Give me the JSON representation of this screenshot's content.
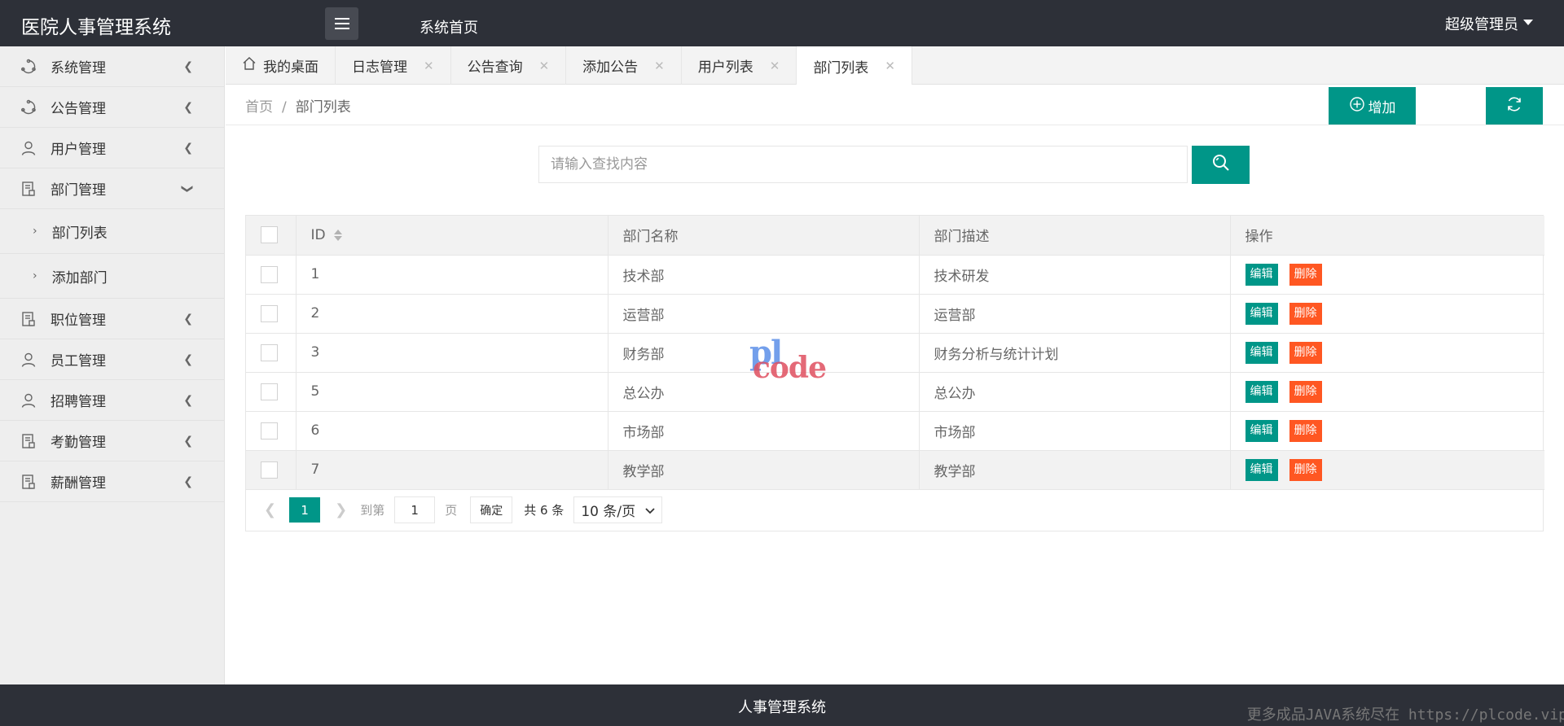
{
  "header": {
    "logo": "医院人事管理系统",
    "home_link": "系统首页",
    "user": "超级管理员"
  },
  "sidebar": {
    "items": [
      {
        "label": "系统管理",
        "icon": "cluster-icon"
      },
      {
        "label": "公告管理",
        "icon": "cluster-icon"
      },
      {
        "label": "用户管理",
        "icon": "user-icon"
      },
      {
        "label": "部门管理",
        "icon": "document-icon"
      },
      {
        "label": "职位管理",
        "icon": "document-icon"
      },
      {
        "label": "员工管理",
        "icon": "user-icon"
      },
      {
        "label": "招聘管理",
        "icon": "user-icon"
      },
      {
        "label": "考勤管理",
        "icon": "document-icon"
      },
      {
        "label": "薪酬管理",
        "icon": "document-icon"
      }
    ],
    "subitems": [
      {
        "label": "部门列表"
      },
      {
        "label": "添加部门"
      }
    ]
  },
  "tabs": [
    {
      "label": "我的桌面",
      "closable": false
    },
    {
      "label": "日志管理",
      "closable": true
    },
    {
      "label": "公告查询",
      "closable": true
    },
    {
      "label": "添加公告",
      "closable": true
    },
    {
      "label": "用户列表",
      "closable": true
    },
    {
      "label": "部门列表",
      "closable": true,
      "active": true
    }
  ],
  "breadcrumb": {
    "home": "首页",
    "sep": "/",
    "current": "部门列表"
  },
  "toolbar": {
    "add_label": "增加"
  },
  "search": {
    "placeholder": "请输入查找内容",
    "value": ""
  },
  "table": {
    "columns": [
      "ID",
      "部门名称",
      "部门描述",
      "操作"
    ],
    "rows": [
      {
        "id": "1",
        "name": "技术部",
        "desc": "技术研发"
      },
      {
        "id": "2",
        "name": "运营部",
        "desc": "运营部"
      },
      {
        "id": "3",
        "name": "财务部",
        "desc": "财务分析与统计计划"
      },
      {
        "id": "5",
        "name": "总公办",
        "desc": "总公办"
      },
      {
        "id": "6",
        "name": "市场部",
        "desc": "市场部"
      },
      {
        "id": "7",
        "name": "教学部",
        "desc": "教学部"
      }
    ],
    "edit_label": "编辑",
    "delete_label": "删除"
  },
  "pagination": {
    "current_page": "1",
    "goto_prefix": "到第",
    "goto_value": "1",
    "goto_suffix": "页",
    "confirm_label": "确定",
    "total": "共 6 条",
    "page_size": "10 条/页"
  },
  "watermark": {
    "line1": "pl",
    "line2": "code"
  },
  "footer": {
    "title": "人事管理系统",
    "note": "更多成品JAVA系统尽在 https://plcode.vip"
  },
  "colors": {
    "primary": "#009688",
    "danger": "#ff5722",
    "header_bg": "#2d3038"
  }
}
